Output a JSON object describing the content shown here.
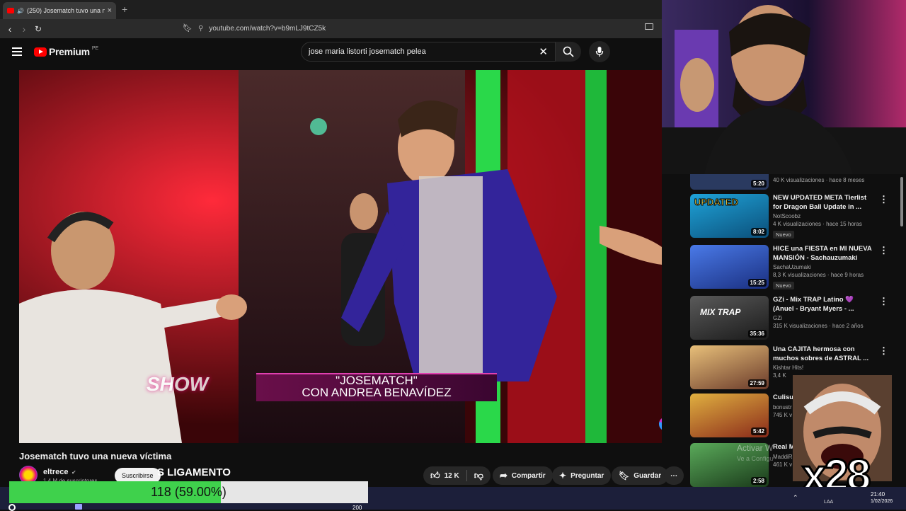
{
  "browser": {
    "tab_title": "(250) Josematch tuvo una nue",
    "url": "youtube.com/watch?v=b9mLJ9tCZ5k"
  },
  "youtube": {
    "logo_text": "Premium",
    "logo_country": "PE",
    "search_query": "jose maria listorti josematch pelea"
  },
  "video": {
    "lower_third_title": "\"JOSEMATCH\"",
    "lower_third_sub": "CON ANDREA BENAVÍDEZ",
    "show_logo": "SHOW",
    "title": "Josematch tuvo una nueva víctima",
    "channel": "eltrece",
    "subscribers": "1,4 M de suscriptores",
    "subscribe_label": "Suscribirse",
    "overlay_text": "S LIGAMENTO",
    "likes": "12 K",
    "share_label": "Compartir",
    "ask_label": "Preguntar",
    "save_label": "Guardar"
  },
  "recommendations": [
    {
      "title": "",
      "channel": "",
      "meta": "40 K visualizaciones · hace 8 meses",
      "duration": "5:20",
      "new": "",
      "thumb_color": "#2a3a60"
    },
    {
      "title": "NEW UPDATED META Tierlist for Dragon Ball Update in ...",
      "channel": "NotScoobz",
      "meta": "4 K visualizaciones · hace 15 horas",
      "duration": "8:02",
      "new": "Nuevo",
      "thumb_color": "#1fa3d8",
      "thumb_text": "UPDATED"
    },
    {
      "title": "HICE una FIESTA en MI NUEVA MANSIÓN - Sachauzumaki",
      "channel": "SachaUzumaki",
      "meta": "8,3 K visualizaciones · hace 9 horas",
      "duration": "15:25",
      "new": "Nuevo",
      "thumb_color": "#2b5fd0"
    },
    {
      "title": "GZi - Mix TRAP Latino 💜 (Anuel - Bryant Myers - ...",
      "channel": "GZi",
      "meta": "315 K visualizaciones · hace 2 años",
      "duration": "35:36",
      "new": "",
      "thumb_color": "#3b3b3b",
      "thumb_text": "MIX TRAP"
    },
    {
      "title": "Una CAJITA hermosa con muchos sobres de ASTRAL ...",
      "channel": "Kishtar Hits!",
      "meta": "3,4 K",
      "duration": "27:59",
      "new": "",
      "thumb_color": "#8a5a3a"
    },
    {
      "title": "Culisue peruan",
      "channel": "bonustr",
      "meta": "745 K v",
      "duration": "5:42",
      "new": "",
      "thumb_color": "#c79a2a"
    },
    {
      "title": "Real M Trondh",
      "channel": "MaddiRi",
      "meta": "461 K v",
      "duration": "2:58",
      "new": "",
      "thumb_color": "#3a7a3a"
    }
  ],
  "stream": {
    "progress_label": "118 (59.00%)",
    "progress_fraction": 0.59,
    "multiplier": "x28",
    "watermark_1": "Activar W",
    "watermark_2": "Ve a Configu"
  },
  "taskbar": {
    "lang": "LAA",
    "time": "21:40",
    "date": "1/02/2026",
    "small_value": "200"
  }
}
